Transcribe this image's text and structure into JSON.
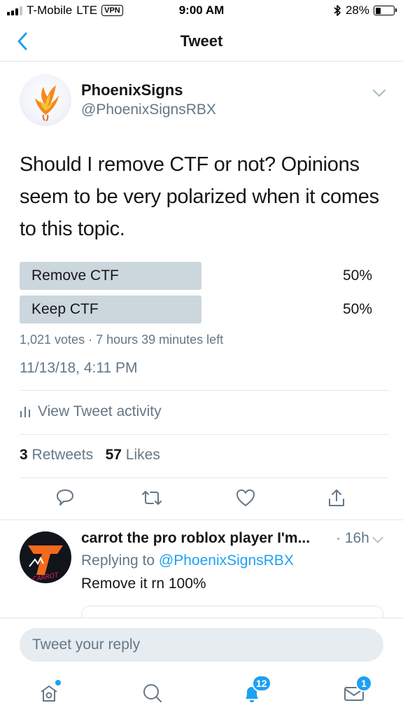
{
  "status_bar": {
    "carrier": "T-Mobile",
    "network": "LTE",
    "vpn": "VPN",
    "time": "9:00 AM",
    "battery": "28%",
    "battery_level": 0.28
  },
  "nav": {
    "title": "Tweet"
  },
  "tweet": {
    "author_name": "PhoenixSigns",
    "author_handle": "@PhoenixSignsRBX",
    "text": "Should I remove CTF or not? Opinions seem to be very polarized when it comes to this topic.",
    "poll": {
      "options": [
        {
          "label": "Remove CTF",
          "percent": "50%",
          "share": 0.5
        },
        {
          "label": "Keep CTF",
          "percent": "50%",
          "share": 0.5
        }
      ],
      "votes": "1,021 votes",
      "time_left": "7 hours 39 minutes left"
    },
    "timestamp": "11/13/18, 4:11 PM",
    "activity_label": "View Tweet activity",
    "retweets_count": "3",
    "retweets_label": "Retweets",
    "likes_count": "57",
    "likes_label": "Likes"
  },
  "reply": {
    "name": "carrot the pro roblox player I'm...",
    "time": "16h",
    "replying_prefix": "Replying to",
    "replying_handle": "@PhoenixSignsRBX",
    "text": "Remove it rn 100%",
    "avatar_text": "CARROT"
  },
  "compose": {
    "placeholder": "Tweet your reply"
  },
  "tab_bar": {
    "notifications_badge": "12",
    "messages_badge": "1"
  },
  "colors": {
    "accent": "#1da1f2",
    "text_primary": "#14171a",
    "text_secondary": "#657786",
    "poll_bar": "#ccd6dd",
    "divider": "#e1e8ed"
  }
}
